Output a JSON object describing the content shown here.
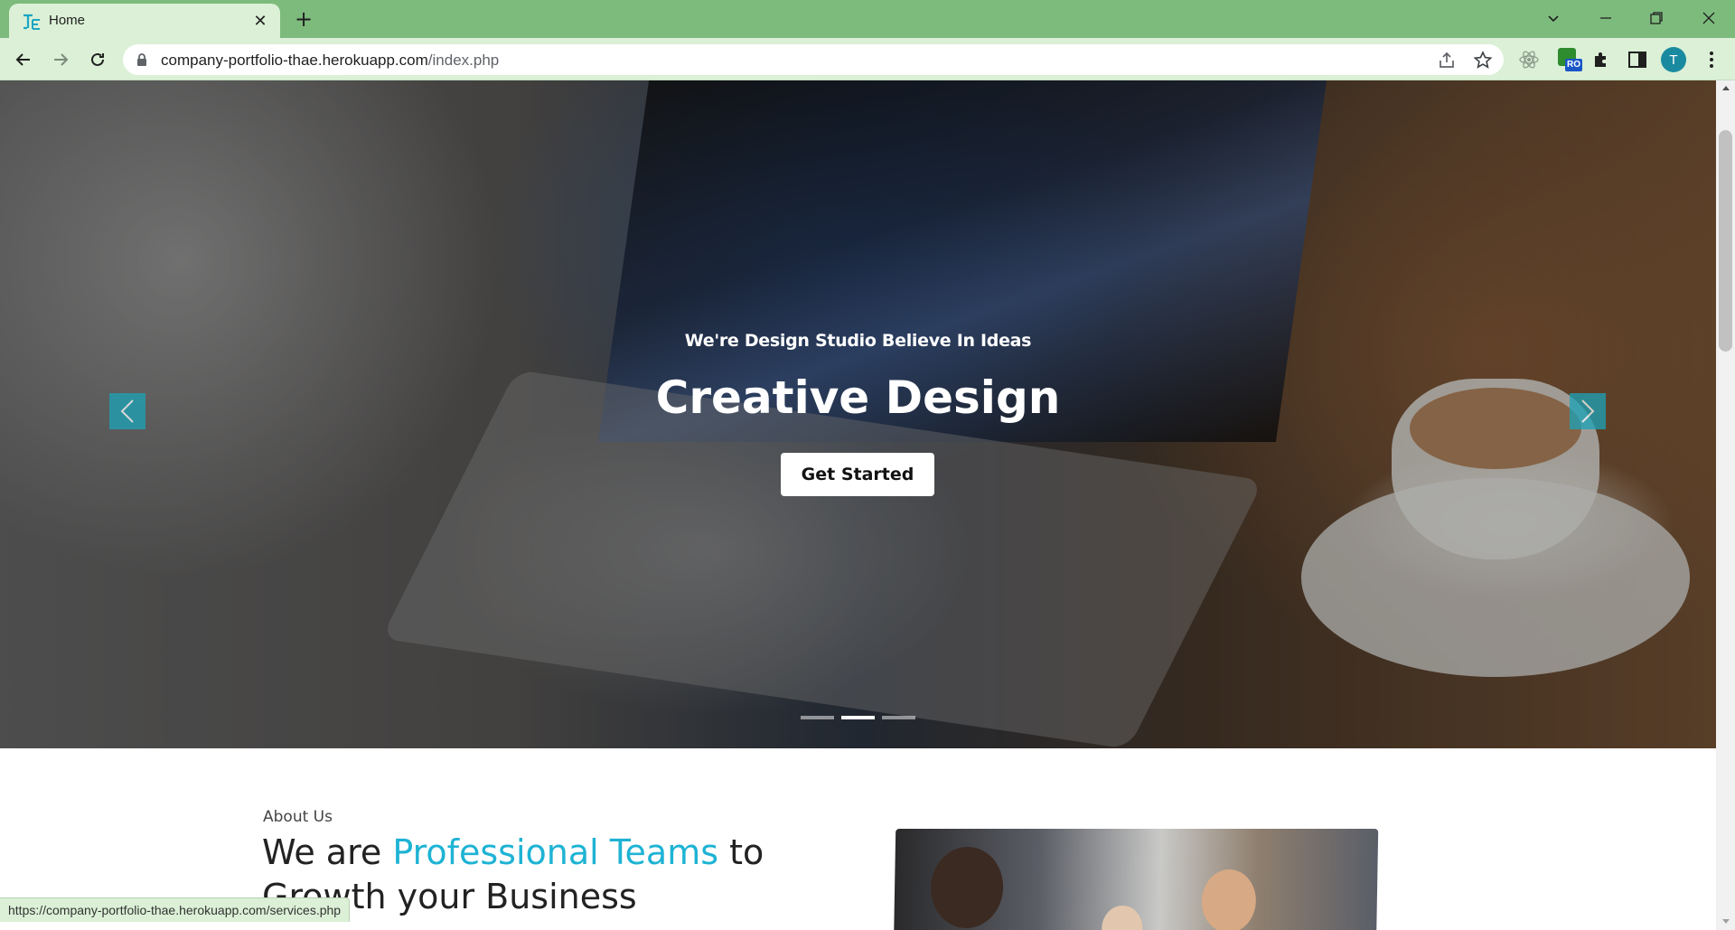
{
  "browser": {
    "tab_title": "Home",
    "url_host": "company-portfolio-thae.herokuapp.com",
    "url_path": "/index.php",
    "profile_initial": "T",
    "extension_badge": "RO",
    "status_url": "https://company-portfolio-thae.herokuapp.com/services.php",
    "theme_color": "#7dbb7d",
    "toolbar_color": "#dbf0d6"
  },
  "hero": {
    "eyebrow": "We're Design Studio Believe In Ideas",
    "title": "Creative Design",
    "cta_label": "Get Started",
    "slides_count": 3,
    "active_slide": 2,
    "accent_color": "#1ba3b8"
  },
  "about": {
    "label": "About Us",
    "heading_prefix": "We are ",
    "heading_accent": "Professional Teams",
    "heading_suffix": " to Growth your Business",
    "accent_color": "#1eb3d4"
  }
}
